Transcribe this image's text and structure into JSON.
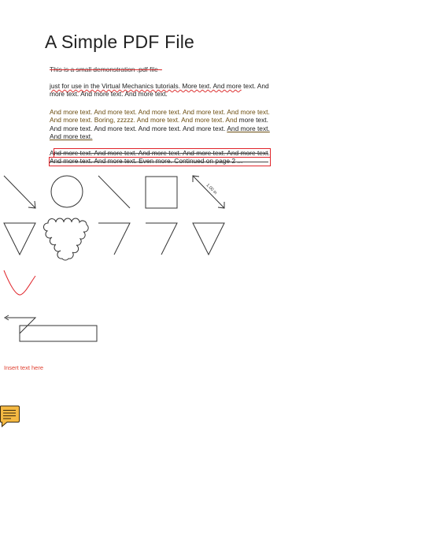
{
  "document": {
    "title": "A Simple PDF File",
    "paragraph1": "This is a small demonstration .pdf file -",
    "paragraph2_underlined": "just for use in the Virtual Mechanics tutorials. More text. And more",
    "paragraph2_rest": "text. And more text. And more text. And more text.",
    "paragraph3_line_a": "And more text. And more text. And more text. And more text. And more text. And more text. Boring, zzzzz. And more text. And more text. And",
    "paragraph3_line_b": "more text. And more text. And more text. And more text. And more text.",
    "paragraph3_underlined": "And more text. And more text.",
    "paragraph4_lead": "A",
    "paragraph4_boxed": "nd more text. And more text. And more text. And more text. And more text. And more text. And more text. Even more. Continued on page 2 ..."
  },
  "annotations": {
    "dimension_label": "1.00 in",
    "insert_text": "Insert text here",
    "accent_red": "#e0252b",
    "ink_color": "#333333",
    "note_icon": "comment-note-icon",
    "note_icon_color": "#f5b942"
  }
}
